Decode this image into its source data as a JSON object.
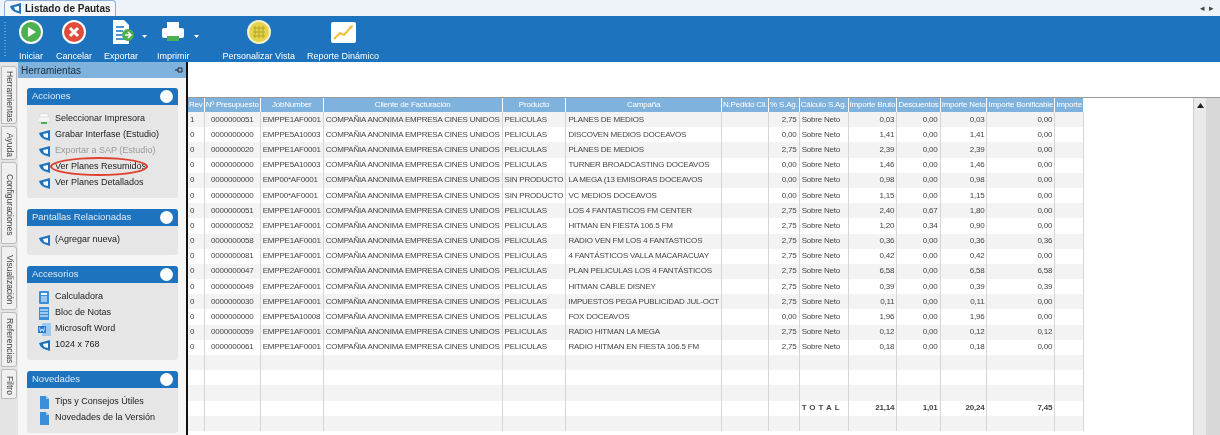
{
  "document_tab": {
    "title": "Listado de Pautas",
    "selected": true
  },
  "tab_scroll": [
    "◂",
    "▸"
  ],
  "toolbar": [
    {
      "label": "Iniciar",
      "kind": "play",
      "dropdown": false
    },
    {
      "label": "Cancelar",
      "kind": "cancel",
      "dropdown": false
    },
    {
      "label": "Exportar",
      "kind": "export",
      "dropdown": true
    },
    {
      "label": "Imprimir",
      "kind": "print",
      "dropdown": true
    },
    {
      "label": "Personalizar Vista",
      "kind": "grid",
      "dropdown": false
    },
    {
      "label": "Reporte Dinámico",
      "kind": "chart",
      "dropdown": false
    }
  ],
  "side_tabs": [
    "Herramientas",
    "Ayuda",
    "Configuraciones",
    "Visualización",
    "Referencias",
    "Filtro"
  ],
  "panel": {
    "title": "Herramientas",
    "groups": [
      {
        "title": "Acciones",
        "items": [
          {
            "label": "Seleccionar Impresora",
            "kind": "printer",
            "disabled": false,
            "circled": false
          },
          {
            "label": "Grabar Interfase (Estudio)",
            "kind": "app",
            "disabled": false,
            "circled": false
          },
          {
            "label": "Exportar a SAP (Estudio)",
            "kind": "app",
            "disabled": true,
            "circled": false
          },
          {
            "label": "Ver Planes Resumidos",
            "kind": "app",
            "disabled": false,
            "circled": true
          },
          {
            "label": "Ver Planes Detallados",
            "kind": "app",
            "disabled": false,
            "circled": false
          }
        ]
      },
      {
        "title": "Pantallas Relacionadas",
        "items": [
          {
            "label": "(Agregar nueva)",
            "kind": "app",
            "disabled": false,
            "circled": false
          }
        ]
      },
      {
        "title": "Accesorios",
        "items": [
          {
            "label": "Calculadora",
            "kind": "calculator",
            "disabled": false,
            "circled": false
          },
          {
            "label": "Bloc de Notas",
            "kind": "notepad",
            "disabled": false,
            "circled": false
          },
          {
            "label": "Microsoft Word",
            "kind": "word",
            "disabled": false,
            "circled": false
          },
          {
            "label": "1024 x 768",
            "kind": "app",
            "disabled": false,
            "circled": false
          }
        ]
      },
      {
        "title": "Novedades",
        "items": [
          {
            "label": "Tips y Consejos Útiles",
            "kind": "document",
            "disabled": false,
            "circled": false
          },
          {
            "label": "Novedades de la Versión",
            "kind": "document",
            "disabled": false,
            "circled": false
          }
        ]
      }
    ]
  },
  "table": {
    "columns": [
      "Rev",
      "Nº Presupuesto",
      "JobNumber",
      "Cliente de Facturación",
      "Producto",
      "Campaña",
      "N.Pedido Cli.",
      "% S.Ag.",
      "Cálculo S.Ag.",
      "Importe Bruto",
      "Descuentos",
      "Importe Neto",
      "Importe Bonificable",
      "Importe"
    ],
    "rows": [
      {
        "rev": "1",
        "presupuesto": "0000000051",
        "job_number": "EMPPE1AF0001",
        "cliente": "COMPAÑIA ANONIMA EMPRESA CINES UNIDOS",
        "producto": "PELICULAS",
        "campana": "PLANES DE MEDIOS",
        "pct_sag": "2,75",
        "calculo": "Sobre Neto",
        "bruto": "0,03",
        "descuentos": "0,00",
        "neto": "0,03",
        "bonificable": "0,00"
      },
      {
        "rev": "0",
        "presupuesto": "0000000000",
        "job_number": "EMPPE5A10003",
        "cliente": "COMPAÑIA ANONIMA EMPRESA CINES UNIDOS",
        "producto": "PELICULAS",
        "campana": "DISCOVEN MEDIOS DOCEAVOS",
        "pct_sag": "0,00",
        "calculo": "Sobre Neto",
        "bruto": "1,41",
        "descuentos": "0,00",
        "neto": "1,41",
        "bonificable": "0,00"
      },
      {
        "rev": "0",
        "presupuesto": "0000000020",
        "job_number": "EMPPE1AF0001",
        "cliente": "COMPAÑIA ANONIMA EMPRESA CINES UNIDOS",
        "producto": "PELICULAS",
        "campana": "PLANES DE MEDIOS",
        "pct_sag": "2,75",
        "calculo": "Sobre Neto",
        "bruto": "2,39",
        "descuentos": "0,00",
        "neto": "2,39",
        "bonificable": "0,00"
      },
      {
        "rev": "0",
        "presupuesto": "0000000000",
        "job_number": "EMPPE5A10003",
        "cliente": "COMPAÑIA ANONIMA EMPRESA CINES UNIDOS",
        "producto": "PELICULAS",
        "campana": "TURNER BROADCASTING DOCEAVOS",
        "pct_sag": "0,00",
        "calculo": "Sobre Neto",
        "bruto": "1,46",
        "descuentos": "0,00",
        "neto": "1,46",
        "bonificable": "0,00"
      },
      {
        "rev": "0",
        "presupuesto": "0000000000",
        "job_number": "EMP00*AF0001",
        "cliente": "COMPAÑIA ANONIMA EMPRESA CINES UNIDOS",
        "producto": "SIN PRODUCTO",
        "campana": "LA MEGA (13 EMISORAS DOCEAVOS",
        "pct_sag": "0,00",
        "calculo": "Sobre Neto",
        "bruto": "0,98",
        "descuentos": "0,00",
        "neto": "0,98",
        "bonificable": "0,00"
      },
      {
        "rev": "0",
        "presupuesto": "0000000000",
        "job_number": "EMP00*AF0001",
        "cliente": "COMPAÑIA ANONIMA EMPRESA CINES UNIDOS",
        "producto": "SIN PRODUCTO",
        "campana": "VC MEDIOS DOCEAVOS",
        "pct_sag": "0,00",
        "calculo": "Sobre Neto",
        "bruto": "1,15",
        "descuentos": "0,00",
        "neto": "1,15",
        "bonificable": "0,00"
      },
      {
        "rev": "0",
        "presupuesto": "0000000051",
        "job_number": "EMPPE1AF0001",
        "cliente": "COMPAÑIA ANONIMA EMPRESA CINES UNIDOS",
        "producto": "PELICULAS",
        "campana": "LOS 4 FANTASTICOS FM CENTER",
        "pct_sag": "2,75",
        "calculo": "Sobre Neto",
        "bruto": "2,40",
        "descuentos": "0,67",
        "neto": "1,80",
        "bonificable": "0,00"
      },
      {
        "rev": "0",
        "presupuesto": "0000000052",
        "job_number": "EMPPE1AF0001",
        "cliente": "COMPAÑIA ANONIMA EMPRESA CINES UNIDOS",
        "producto": "PELICULAS",
        "campana": "HITMAN EN FIESTA 106.5 FM",
        "pct_sag": "2,75",
        "calculo": "Sobre Neto",
        "bruto": "1,20",
        "descuentos": "0,34",
        "neto": "0,90",
        "bonificable": "0,00"
      },
      {
        "rev": "0",
        "presupuesto": "0000000058",
        "job_number": "EMPPE1AF0001",
        "cliente": "COMPAÑIA ANONIMA EMPRESA CINES UNIDOS",
        "producto": "PELICULAS",
        "campana": "RADIO VEN FM LOS 4 FANTASTICOS",
        "pct_sag": "2,75",
        "calculo": "Sobre Neto",
        "bruto": "0,36",
        "descuentos": "0,00",
        "neto": "0,36",
        "bonificable": "0,36"
      },
      {
        "rev": "0",
        "presupuesto": "0000000081",
        "job_number": "EMPPE1AF0001",
        "cliente": "COMPAÑIA ANONIMA EMPRESA CINES UNIDOS",
        "producto": "PELICULAS",
        "campana": "4 FANTÁSTICOS VALLA MACARACUAY",
        "pct_sag": "2,75",
        "calculo": "Sobre Neto",
        "bruto": "0,42",
        "descuentos": "0,00",
        "neto": "0,42",
        "bonificable": "0,00"
      },
      {
        "rev": "0",
        "presupuesto": "0000000047",
        "job_number": "EMPPE2AF0001",
        "cliente": "COMPAÑIA ANONIMA EMPRESA CINES UNIDOS",
        "producto": "PELICULAS",
        "campana": "PLAN PELICULAS LOS 4 FANTÁSTICOS",
        "pct_sag": "2,75",
        "calculo": "Sobre Neto",
        "bruto": "6,58",
        "descuentos": "0,00",
        "neto": "6,58",
        "bonificable": "6,58"
      },
      {
        "rev": "0",
        "presupuesto": "0000000049",
        "job_number": "EMPPE2AF0001",
        "cliente": "COMPAÑIA ANONIMA EMPRESA CINES UNIDOS",
        "producto": "PELICULAS",
        "campana": "HITMAN CABLE DISNEY",
        "pct_sag": "2,75",
        "calculo": "Sobre Neto",
        "bruto": "0,39",
        "descuentos": "0,00",
        "neto": "0,39",
        "bonificable": "0,39"
      },
      {
        "rev": "0",
        "presupuesto": "0000000030",
        "job_number": "EMPPE1AF0001",
        "cliente": "COMPAÑIA ANONIMA EMPRESA CINES UNIDOS",
        "producto": "PELICULAS",
        "campana": "IMPUESTOS PEGA PUBLICIDAD JUL-OCT",
        "pct_sag": "2,75",
        "calculo": "Sobre Neto",
        "bruto": "0,11",
        "descuentos": "0,00",
        "neto": "0,11",
        "bonificable": "0,00"
      },
      {
        "rev": "0",
        "presupuesto": "0000000000",
        "job_number": "EMPPE5A10008",
        "cliente": "COMPAÑIA ANONIMA EMPRESA CINES UNIDOS",
        "producto": "PELICULAS",
        "campana": "FOX DOCEAVOS",
        "pct_sag": "0,00",
        "calculo": "Sobre Neto",
        "bruto": "1,96",
        "descuentos": "0,00",
        "neto": "1,96",
        "bonificable": "0,00"
      },
      {
        "rev": "0",
        "presupuesto": "0000000059",
        "job_number": "EMPPE1AF0001",
        "cliente": "COMPAÑIA ANONIMA EMPRESA CINES UNIDOS",
        "producto": "PELICULAS",
        "campana": "RADIO HITMAN LA MEGA",
        "pct_sag": "2,75",
        "calculo": "Sobre Neto",
        "bruto": "0,12",
        "descuentos": "0,00",
        "neto": "0,12",
        "bonificable": "0,12"
      },
      {
        "rev": "0",
        "presupuesto": "0000000061",
        "job_number": "EMPPE1AF0001",
        "cliente": "COMPAÑIA ANONIMA EMPRESA CINES UNIDOS",
        "producto": "PELICULAS",
        "campana": "RADIO HITMAN EN FIESTA 106.5 FM",
        "pct_sag": "2,75",
        "calculo": "Sobre Neto",
        "bruto": "0,18",
        "descuentos": "0,00",
        "neto": "0,18",
        "bonificable": "0,00"
      }
    ],
    "totals": {
      "calculo": "TOTAL",
      "bruto": "21,14",
      "descuentos": "1,01",
      "neto": "20,24",
      "bonificable": "7,45"
    }
  }
}
